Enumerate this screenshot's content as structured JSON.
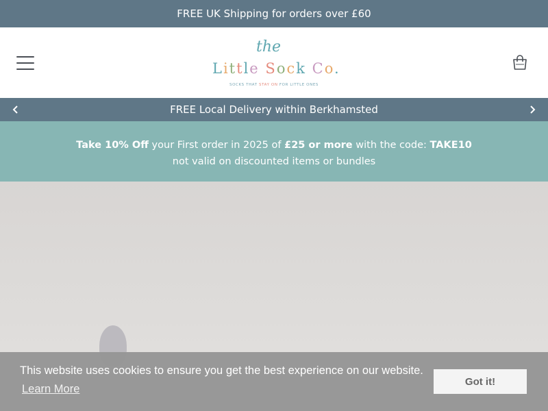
{
  "top_bar": {
    "text": "FREE UK Shipping for orders over £60"
  },
  "header": {
    "menu_icon": "hamburger-menu-icon",
    "cart_icon": "shopping-bag-icon",
    "logo": {
      "the": "the",
      "letters": [
        {
          "ch": "L",
          "color": "#5fa7b0"
        },
        {
          "ch": "i",
          "color": "#e7a96b"
        },
        {
          "ch": "t",
          "color": "#8fb07b"
        },
        {
          "ch": "t",
          "color": "#e58a7c"
        },
        {
          "ch": "l",
          "color": "#5fa7b0"
        },
        {
          "ch": "e",
          "color": "#c89ac0"
        },
        {
          "ch": " ",
          "color": "#5fa7b0"
        },
        {
          "ch": "S",
          "color": "#e58a7c"
        },
        {
          "ch": "o",
          "color": "#8fb07b"
        },
        {
          "ch": "c",
          "color": "#e7a96b"
        },
        {
          "ch": "k",
          "color": "#5fa7b0"
        },
        {
          "ch": " ",
          "color": "#5fa7b0"
        },
        {
          "ch": "C",
          "color": "#c89ac0"
        },
        {
          "ch": "o",
          "color": "#e7a96b"
        },
        {
          "ch": ".",
          "color": "#5fa7b0"
        }
      ],
      "tagline_start": "SOCKS THAT ",
      "tagline_highlight": "STAY ON",
      "tagline_end": " FOR LITTLE ONES"
    }
  },
  "announcement": {
    "text": "FREE Local Delivery within Berkhamsted",
    "prev_icon": "chevron-left-icon",
    "next_icon": "chevron-right-icon"
  },
  "promo": {
    "line1_bold1": "Take 10% Off",
    "line1_text1": " your First order in 2025 of ",
    "line1_bold2": "£25 or more",
    "line1_text2": " with the code: ",
    "line1_code": "TAKE10",
    "line2": "not valid on discounted items or bundles"
  },
  "cookie": {
    "message": "This website uses cookies to ensure you get the best experience on our website.",
    "learn_more": "Learn More",
    "button": "Got it!"
  },
  "colors": {
    "bar": "#5f7787",
    "promo": "#87b6b4"
  }
}
